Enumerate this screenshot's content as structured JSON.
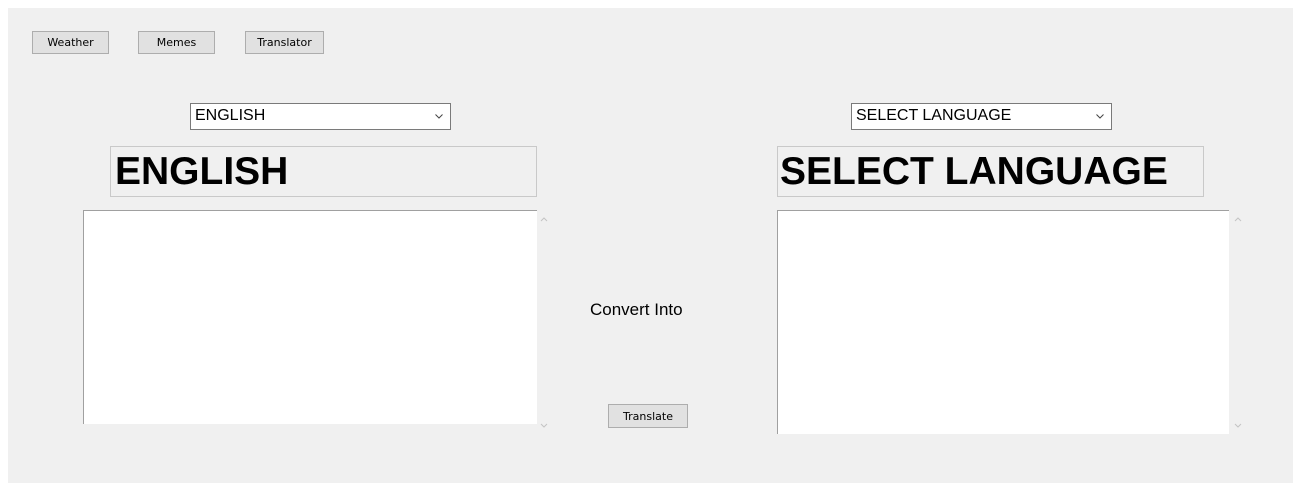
{
  "nav": {
    "weather_label": "Weather",
    "memes_label": "Memes",
    "translator_label": "Translator"
  },
  "source": {
    "selected_language": "ENGLISH",
    "display_label": "ENGLISH",
    "text": ""
  },
  "target": {
    "selected_language": "SELECT LANGUAGE",
    "display_label": "SELECT LANGUAGE",
    "text": ""
  },
  "middle": {
    "convert_label": "Convert Into",
    "translate_label": "Translate"
  },
  "icons": {
    "dropdown": "chevron-down-icon",
    "scroll_up": "scroll-up-arrow-icon",
    "scroll_down": "scroll-down-arrow-icon"
  },
  "colors": {
    "window_background": "#f0f0f0",
    "button_background": "#e1e1e1",
    "textbox_background": "#ffffff"
  }
}
